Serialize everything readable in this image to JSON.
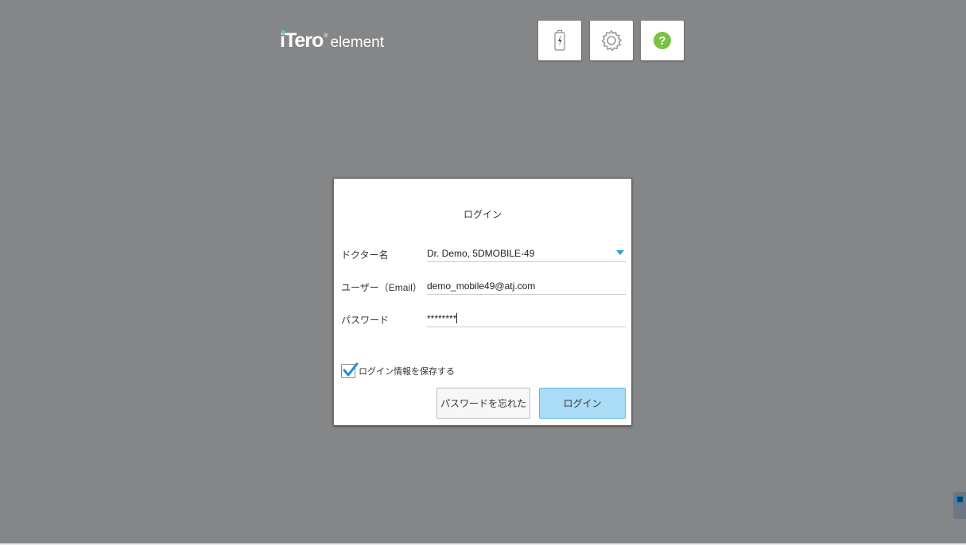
{
  "brand": {
    "name": "iTero",
    "reg_mark": "®",
    "product": "element",
    "accent_color": "#4fd1c5"
  },
  "toolbar": {
    "battery_icon": "battery-charging-icon",
    "settings_icon": "gear-icon",
    "help_icon": "help-icon",
    "help_glyph": "?"
  },
  "login": {
    "title": "ログイン",
    "doctor": {
      "label": "ドクター名",
      "value": "Dr. Demo, 5DMOBILE-49"
    },
    "user": {
      "label": "ユーザー（Email）",
      "value": "demo_mobile49@atj.com"
    },
    "password": {
      "label": "パスワード",
      "value": "********"
    },
    "remember": {
      "label": "ログイン情報を保存する",
      "checked": true
    },
    "forgot_button": "パスワードを忘れた",
    "login_button": "ログイン"
  },
  "colors": {
    "background": "#858687",
    "login_button": "#aadcf5",
    "dropdown_arrow": "#2a9fd8",
    "help_icon": "#7cc242"
  }
}
